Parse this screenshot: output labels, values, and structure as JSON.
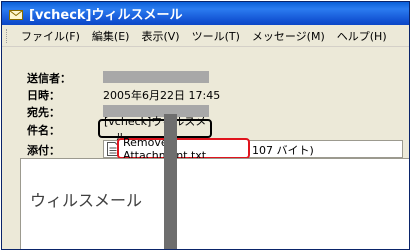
{
  "window": {
    "title": "[vcheck]ウィルスメール"
  },
  "menu": {
    "items": [
      {
        "label": "ファイル(F)"
      },
      {
        "label": "編集(E)"
      },
      {
        "label": "表示(V)"
      },
      {
        "label": "ツール(T)"
      },
      {
        "label": "メッセージ(M)"
      },
      {
        "label": "ヘルプ(H)"
      }
    ]
  },
  "header": {
    "from_label": "送信者：",
    "date_label": "日時：",
    "date_value": "2005年6月22日 17:45",
    "to_label": "宛先：",
    "subject_label": "件名：",
    "subject_value": "[vcheck]ウィルスメール",
    "attach_label": "添付：",
    "attachment_name": "Removed Attachment.txt",
    "attachment_size": "107 バイト)"
  },
  "body": {
    "text": "ウィルスメール"
  },
  "colors": {
    "titlebar": "#1557d6",
    "highlight_subject": "#000000",
    "highlight_attachment": "#e0141d",
    "redaction": "#a8a8a8"
  },
  "icons": {
    "title": "envelope-icon",
    "attachment": "text-file-icon"
  }
}
